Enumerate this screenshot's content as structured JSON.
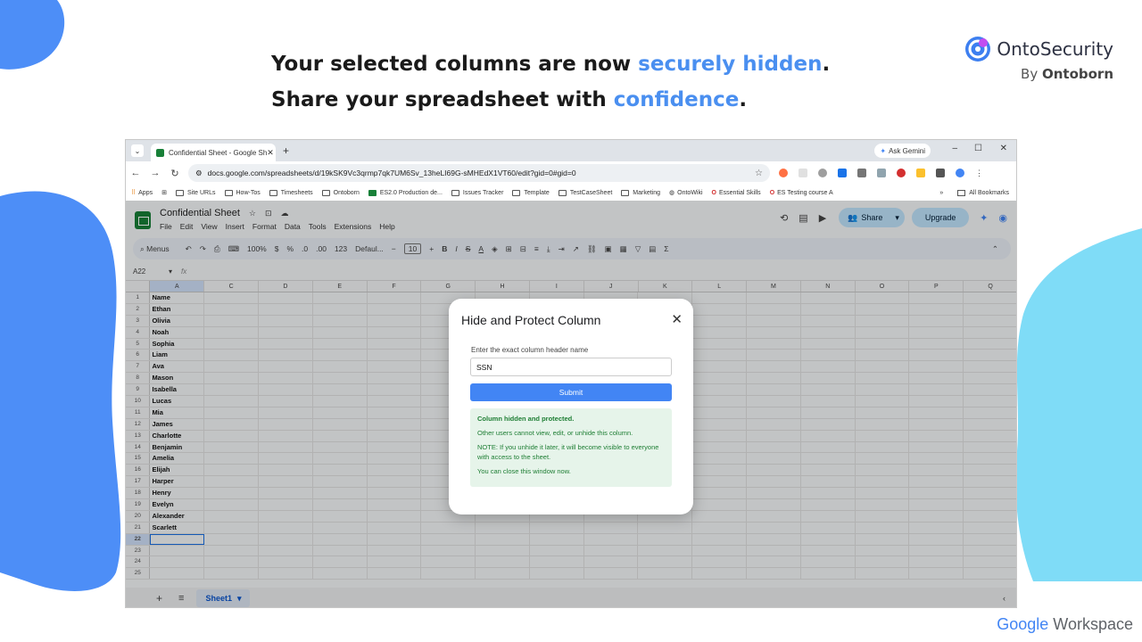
{
  "headline": {
    "part1": "Your selected columns are now ",
    "highlight1": "securely hidden",
    "part2": ". Share your spreadsheet with ",
    "highlight2": "confidence",
    "part3": "."
  },
  "brand": {
    "name": "OntoSecurity",
    "by_prefix": "By ",
    "by_name": "Ontoborn"
  },
  "footer_brand": {
    "google": "Google",
    "workspace": "Workspace"
  },
  "colors": {
    "accent": "#4a8ff0",
    "submit": "#4285f4",
    "success_bg": "#e6f4ea",
    "success_text": "#1e7e34",
    "blob_left": "#4d8ef7",
    "blob_right": "#7fdcf7"
  },
  "browser": {
    "tab_title": "Confidential Sheet - Google Sh",
    "ask_gemini": "Ask Gemini",
    "url": "docs.google.com/spreadsheets/d/19kSK9Vc3qrmp7qk7UM6Sv_13heLI69G-sMHEdX1VT60/edit?gid=0#gid=0",
    "bookmarks": [
      "Apps",
      "Site URLs",
      "How-Tos",
      "Timesheets",
      "Ontoborn",
      "ES2.0 Production de...",
      "Issues Tracker",
      "Template",
      "TestCaseSheet",
      "Marketing",
      "OntoWiki",
      "Essential Skills",
      "ES Testing course A"
    ],
    "all_bookmarks": "All Bookmarks"
  },
  "sheets": {
    "doc_title": "Confidential Sheet",
    "menus": [
      "File",
      "Edit",
      "View",
      "Insert",
      "Format",
      "Data",
      "Tools",
      "Extensions",
      "Help"
    ],
    "share_label": "Share",
    "upgrade_label": "Upgrade",
    "toolbar": {
      "menus": "Menus",
      "zoom": "100%",
      "currency": "$",
      "percent": "%",
      "dec_dec": ".0",
      "dec_inc": ".00",
      "num": "123",
      "font": "Defaul...",
      "font_size": "10"
    },
    "name_box": "A22",
    "fx": "fx",
    "columns": [
      "A",
      "C",
      "D",
      "E",
      "F",
      "G",
      "H",
      "I",
      "J",
      "K",
      "L",
      "M",
      "N",
      "O",
      "P",
      "Q"
    ],
    "rows": [
      {
        "n": "1",
        "a": "Name"
      },
      {
        "n": "2",
        "a": "Ethan"
      },
      {
        "n": "3",
        "a": "Olivia"
      },
      {
        "n": "4",
        "a": "Noah"
      },
      {
        "n": "5",
        "a": "Sophia"
      },
      {
        "n": "6",
        "a": "Liam"
      },
      {
        "n": "7",
        "a": "Ava"
      },
      {
        "n": "8",
        "a": "Mason"
      },
      {
        "n": "9",
        "a": "Isabella"
      },
      {
        "n": "10",
        "a": "Lucas"
      },
      {
        "n": "11",
        "a": "Mia"
      },
      {
        "n": "12",
        "a": "James"
      },
      {
        "n": "13",
        "a": "Charlotte"
      },
      {
        "n": "14",
        "a": "Benjamin"
      },
      {
        "n": "15",
        "a": "Amelia"
      },
      {
        "n": "16",
        "a": "Elijah"
      },
      {
        "n": "17",
        "a": "Harper"
      },
      {
        "n": "18",
        "a": "Henry"
      },
      {
        "n": "19",
        "a": "Evelyn"
      },
      {
        "n": "20",
        "a": "Alexander"
      },
      {
        "n": "21",
        "a": "Scarlett"
      },
      {
        "n": "22",
        "a": ""
      },
      {
        "n": "23",
        "a": ""
      },
      {
        "n": "24",
        "a": ""
      },
      {
        "n": "25",
        "a": ""
      }
    ],
    "sheet_tab": "Sheet1"
  },
  "dialog": {
    "title": "Hide and Protect Column",
    "label": "Enter the exact column header name",
    "input_value": "SSN",
    "submit": "Submit",
    "msg_title": "Column hidden and protected.",
    "msg_line1": "Other users cannot view, edit, or unhide this column.",
    "msg_line2": "NOTE: If you unhide it later, it will become visible to everyone with access to the sheet.",
    "msg_line3": "You can close this window now."
  }
}
